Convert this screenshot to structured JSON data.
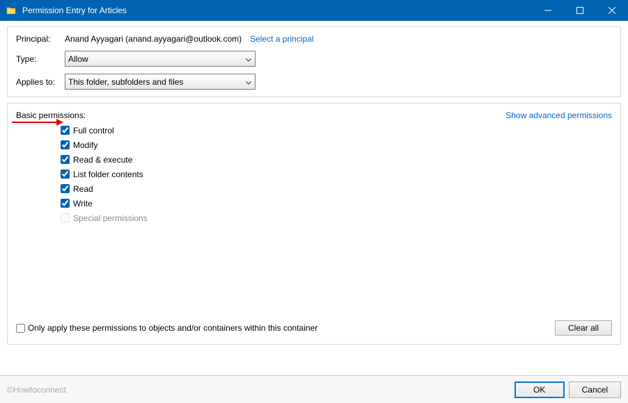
{
  "titlebar": {
    "title": "Permission Entry for Articles"
  },
  "principal": {
    "label": "Principal:",
    "value": "Anand Ayyagari (anand.ayyagari@outlook.com)",
    "select_link": "Select a principal"
  },
  "type": {
    "label": "Type:",
    "value": "Allow"
  },
  "applies": {
    "label": "Applies to:",
    "value": "This folder, subfolders and files"
  },
  "permissions": {
    "heading": "Basic permissions:",
    "advanced_link": "Show advanced permissions",
    "items": [
      {
        "label": "Full control",
        "checked": true,
        "disabled": false
      },
      {
        "label": "Modify",
        "checked": true,
        "disabled": false
      },
      {
        "label": "Read & execute",
        "checked": true,
        "disabled": false
      },
      {
        "label": "List folder contents",
        "checked": true,
        "disabled": false
      },
      {
        "label": "Read",
        "checked": true,
        "disabled": false
      },
      {
        "label": "Write",
        "checked": true,
        "disabled": false
      },
      {
        "label": "Special permissions",
        "checked": false,
        "disabled": true
      }
    ]
  },
  "only_apply": {
    "label": "Only apply these permissions to objects and/or containers within this container",
    "checked": false
  },
  "buttons": {
    "clear_all": "Clear all",
    "ok": "OK",
    "cancel": "Cancel"
  },
  "watermark": "©Howtoconnect"
}
